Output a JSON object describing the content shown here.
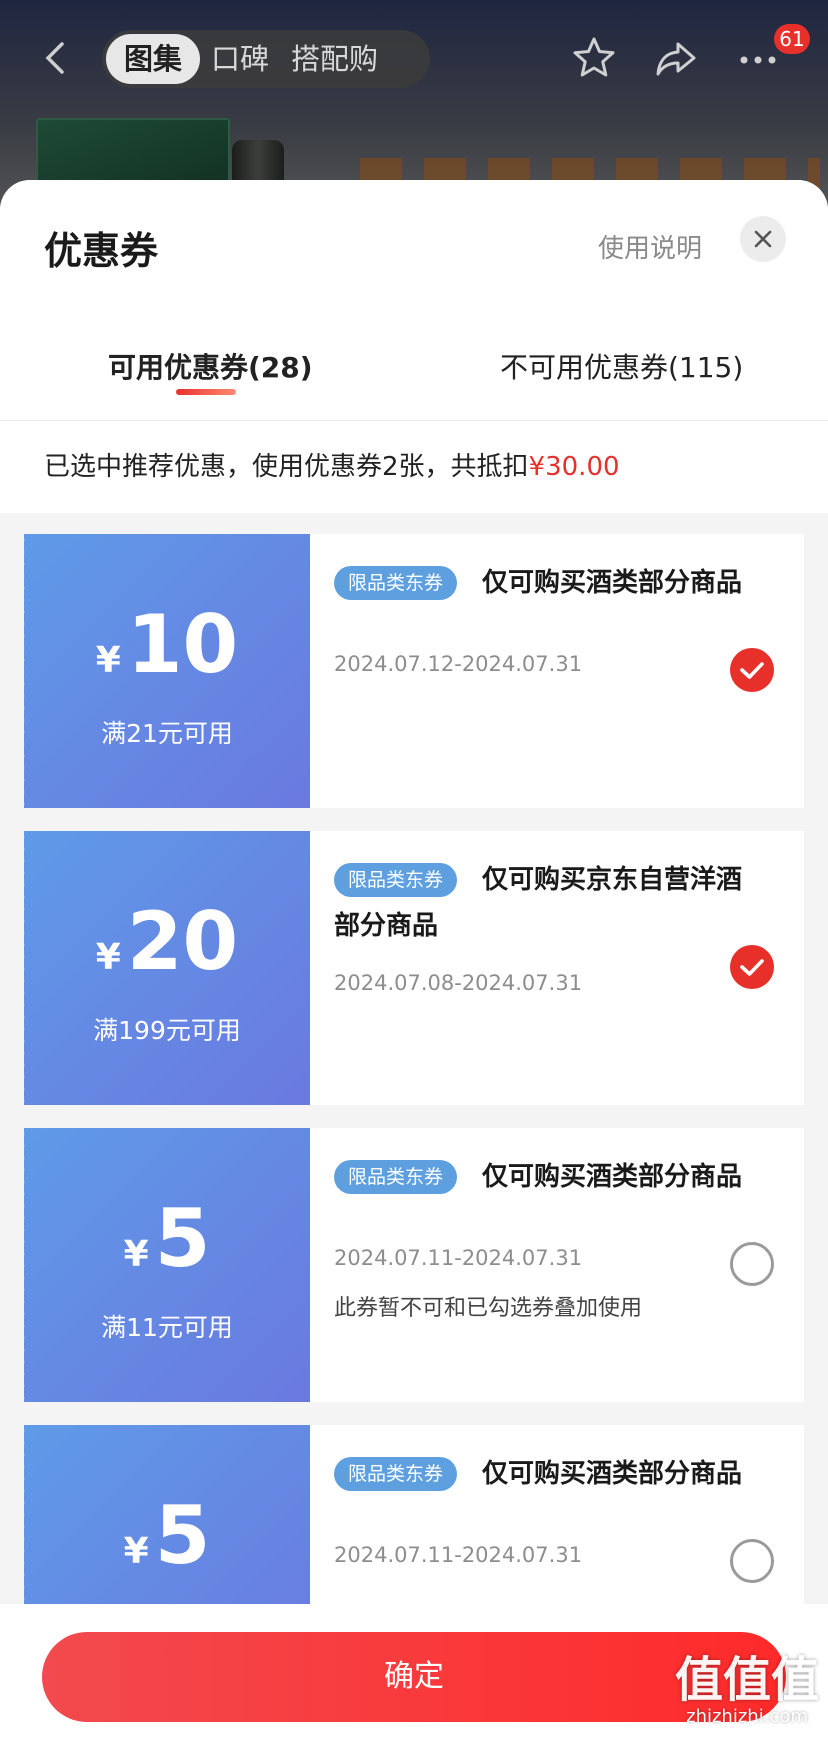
{
  "nav": {
    "tabs": [
      "图集",
      "口碑",
      "搭配购"
    ],
    "active_tab": "图集",
    "badge_count": "61"
  },
  "sheet": {
    "title": "优惠券",
    "usage_link": "使用说明",
    "tabs": {
      "available": "可用优惠券(28)",
      "unavailable": "不可用优惠券(115)"
    },
    "summary_prefix": "已选中推荐优惠，使用优惠券2张，共抵扣",
    "summary_amount": "¥30.00"
  },
  "coupons": [
    {
      "yen": "¥",
      "value": "10",
      "threshold": "满21元可用",
      "tag": "限品类东券",
      "title": "仅可购买酒类部分商品",
      "date": "2024.07.12-2024.07.31",
      "note": "",
      "selected": true
    },
    {
      "yen": "¥",
      "value": "20",
      "threshold": "满199元可用",
      "tag": "限品类东券",
      "title": "仅可购买京东自营洋酒部分商品",
      "date": "2024.07.08-2024.07.31",
      "note": "",
      "selected": true
    },
    {
      "yen": "¥",
      "value": "5",
      "threshold": "满11元可用",
      "tag": "限品类东券",
      "title": "仅可购买酒类部分商品",
      "date": "2024.07.11-2024.07.31",
      "note": "此券暂不可和已勾选券叠加使用",
      "selected": false
    },
    {
      "yen": "¥",
      "value": "5",
      "threshold": "",
      "tag": "限品类东券",
      "title": "仅可购买酒类部分商品",
      "date": "2024.07.11-2024.07.31",
      "note": "",
      "selected": false
    }
  ],
  "footer": {
    "confirm_label": "确定"
  },
  "watermark": {
    "logo": "值值值",
    "url": "zhizhizhi.com"
  },
  "colors": {
    "accent_red": "#e8302b",
    "coupon_blue_start": "#5f9ae8",
    "coupon_blue_end": "#6a79df",
    "tag_blue": "#5ea0df"
  },
  "icons": [
    "back-arrow-icon",
    "star-icon",
    "share-icon",
    "more-icon",
    "close-icon",
    "check-icon"
  ]
}
